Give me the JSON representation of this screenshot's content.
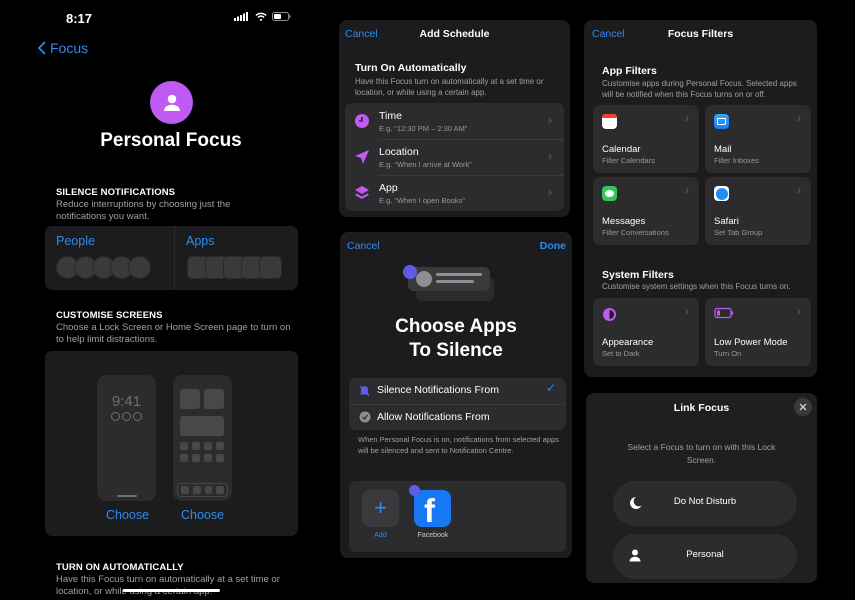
{
  "status_bar": {
    "time": "8:17"
  },
  "focus_page": {
    "back_label": "Focus",
    "title": "Personal Focus",
    "silence": {
      "heading": "SILENCE NOTIFICATIONS",
      "description": "Reduce interruptions by choosing just the notifications you want.",
      "people_label": "People",
      "apps_label": "Apps"
    },
    "customise": {
      "heading": "CUSTOMISE SCREENS",
      "description": "Choose a Lock Screen or Home Screen page to turn on to help limit distractions.",
      "lock_time": "9:41",
      "choose_lock": "Choose",
      "choose_home": "Choose"
    },
    "auto": {
      "heading": "TURN ON AUTOMATICALLY",
      "description": "Have this Focus turn on automatically at a set time or location, or while using a certain app."
    }
  },
  "schedule": {
    "cancel": "Cancel",
    "title": "Add Schedule",
    "heading": "Turn On Automatically",
    "description": "Have this Focus turn on automatically at a set time or location, or while using a certain app.",
    "rows": [
      {
        "icon": "clock-icon",
        "title": "Time",
        "subtitle": "E.g. “12:30 PM – 2:30 AM”"
      },
      {
        "icon": "location-arrow-icon",
        "title": "Location",
        "subtitle": "E.g. “When I arrive at Work”"
      },
      {
        "icon": "app-stack-icon",
        "title": "App",
        "subtitle": "E.g. “When I open Books”"
      }
    ]
  },
  "choose_apps": {
    "cancel": "Cancel",
    "done": "Done",
    "title_line1": "Choose Apps",
    "title_line2": "To Silence",
    "options": [
      {
        "label": "Silence Notifications From",
        "selected": true
      },
      {
        "label": "Allow Notifications From",
        "selected": false
      }
    ],
    "footnote": "When Personal Focus is on, notifications from selected apps will be silenced and sent to Notification Centre.",
    "add_label": "Add",
    "apps": [
      {
        "name": "Facebook"
      }
    ]
  },
  "filters": {
    "cancel": "Cancel",
    "title": "Focus Filters",
    "app_heading": "App Filters",
    "app_description": "Customise apps during Personal Focus. Selected apps will be notified when this Focus turns on or off.",
    "app_tiles": [
      {
        "title": "Calendar",
        "subtitle": "Filter Calendars"
      },
      {
        "title": "Mail",
        "subtitle": "Filter Inboxes"
      },
      {
        "title": "Messages",
        "subtitle": "Filter Conversations"
      },
      {
        "title": "Safari",
        "subtitle": "Set Tab Group"
      }
    ],
    "system_heading": "System Filters",
    "system_description": "Customise system settings when this Focus turns on.",
    "system_tiles": [
      {
        "title": "Appearance",
        "subtitle": "Set to Dark"
      },
      {
        "title": "Low Power Mode",
        "subtitle": "Turn On"
      }
    ]
  },
  "link_focus": {
    "title": "Link Focus",
    "description": "Select a Focus to turn on with this Lock Screen.",
    "options": [
      {
        "label": "Do Not Disturb"
      },
      {
        "label": "Personal"
      }
    ]
  },
  "colors": {
    "accent": "#2d8cf0",
    "focus_purple": "#bf5af2",
    "indigo": "#5e5ce6"
  }
}
